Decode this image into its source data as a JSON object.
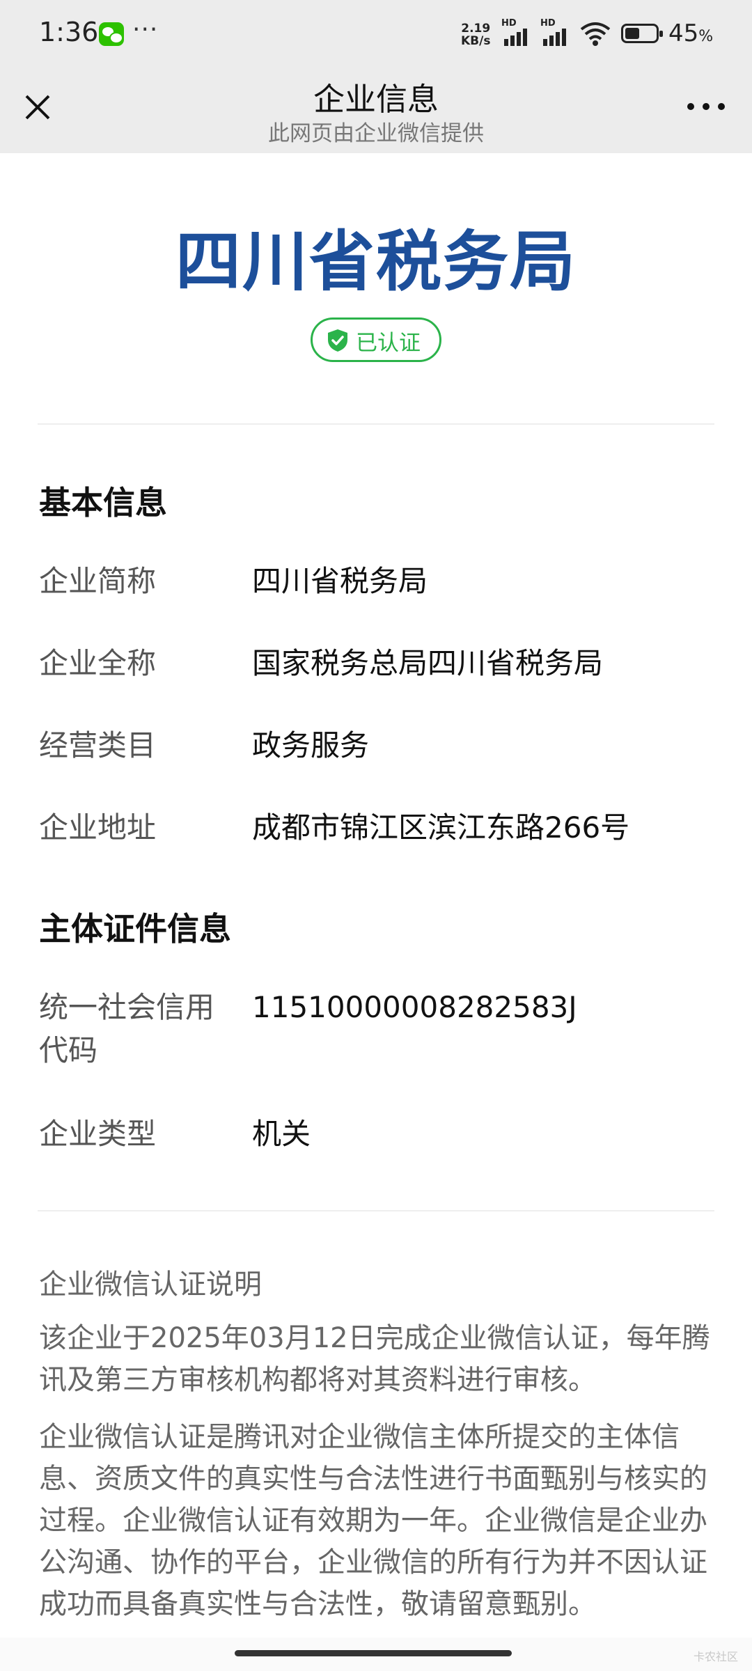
{
  "status_bar": {
    "time": "1:36",
    "more": "···",
    "net_speed_value": "2.19",
    "net_speed_unit": "KB/s",
    "sim1": "HD",
    "sim2": "HD",
    "battery_pct": "45",
    "battery_unit": "%"
  },
  "nav": {
    "title": "企业信息",
    "subtitle": "此网页由企业微信提供"
  },
  "header": {
    "org_name": "四川省税务局",
    "badge": "已认证",
    "badge_color": "#2bb34a",
    "title_color": "#1d4f9a"
  },
  "basic": {
    "title": "基本信息",
    "rows": [
      {
        "label": "企业简称",
        "value": "四川省税务局"
      },
      {
        "label": "企业全称",
        "value": "国家税务总局四川省税务局"
      },
      {
        "label": "经营类目",
        "value": "政务服务"
      },
      {
        "label": "企业地址",
        "value": "成都市锦江区滨江东路266号"
      }
    ]
  },
  "cert": {
    "title": "主体证件信息",
    "rows": [
      {
        "label": "统一社会信用代码",
        "value": "11510000008282583J"
      },
      {
        "label": "企业类型",
        "value": "机关"
      }
    ]
  },
  "desc": {
    "title": "企业微信认证说明",
    "p1": "该企业于2025年03月12日完成企业微信认证，每年腾讯及第三方审核机构都将对其资料进行审核。",
    "p2": "企业微信认证是腾讯对企业微信主体所提交的主体信息、资质文件的真实性与合法性进行书面甄别与核实的过程。企业微信认证有效期为一年。企业微信是企业办公沟通、协作的平台，企业微信的所有行为并不因认证成功而具备真实性与合法性，敬请留意甄别。"
  },
  "watermark": "卡农社区"
}
